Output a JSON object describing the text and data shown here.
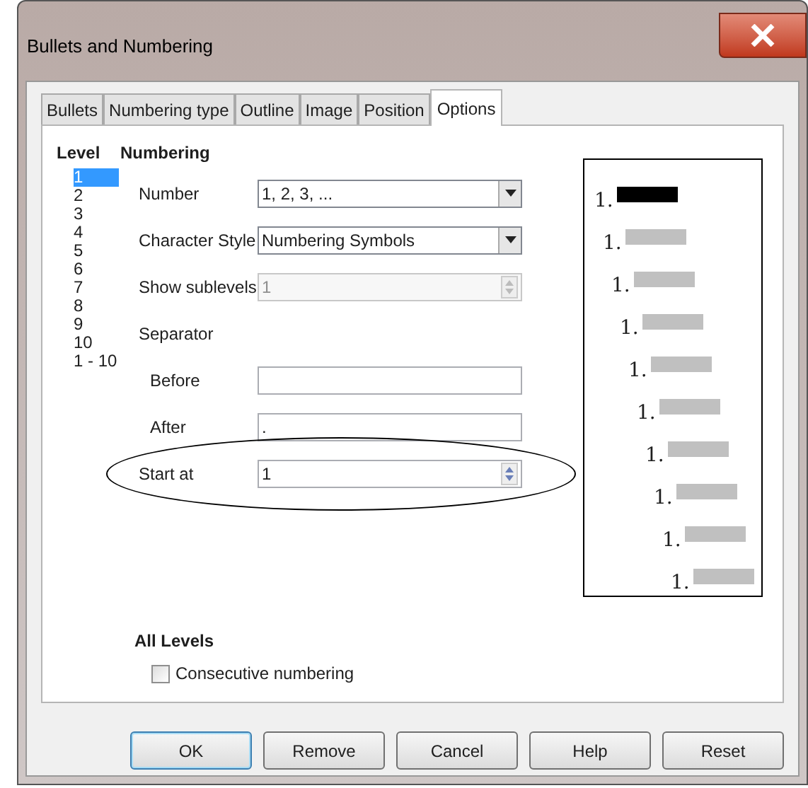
{
  "window": {
    "title": "Bullets and Numbering"
  },
  "tabs": [
    {
      "label": "Bullets",
      "selected": false
    },
    {
      "label": "Numbering type",
      "selected": false
    },
    {
      "label": "Outline",
      "selected": false
    },
    {
      "label": "Image",
      "selected": false
    },
    {
      "label": "Position",
      "selected": false
    },
    {
      "label": "Options",
      "selected": true
    }
  ],
  "level": {
    "heading": "Level",
    "items": [
      {
        "label": "1",
        "selected": true
      },
      {
        "label": "2",
        "selected": false
      },
      {
        "label": "3",
        "selected": false
      },
      {
        "label": "4",
        "selected": false
      },
      {
        "label": "5",
        "selected": false
      },
      {
        "label": "6",
        "selected": false
      },
      {
        "label": "7",
        "selected": false
      },
      {
        "label": "8",
        "selected": false
      },
      {
        "label": "9",
        "selected": false
      },
      {
        "label": "10",
        "selected": false
      },
      {
        "label": "1 - 10",
        "selected": false
      }
    ]
  },
  "numbering": {
    "heading": "Numbering",
    "rows": [
      {
        "kind": "dropdown",
        "label": "Number",
        "value": "1, 2, 3, ...",
        "disabled": false,
        "circled": false
      },
      {
        "kind": "dropdown",
        "label": "Character Style",
        "value": "Numbering Symbols",
        "disabled": false,
        "circled": false
      },
      {
        "kind": "spin",
        "label": "Show sublevels",
        "value": "1",
        "disabled": true,
        "circled": false
      },
      {
        "kind": "heading",
        "label": "Separator"
      },
      {
        "kind": "text",
        "label": "Before",
        "value": "",
        "indented": true
      },
      {
        "kind": "text",
        "label": "After",
        "value": ".",
        "indented": true
      },
      {
        "kind": "spin",
        "label": "Start at",
        "value": "1",
        "disabled": false,
        "circled": true
      }
    ]
  },
  "preview": {
    "lines": [
      {
        "number": "1.",
        "selected": true
      },
      {
        "number": "1.",
        "selected": false
      },
      {
        "number": "1.",
        "selected": false
      },
      {
        "number": "1.",
        "selected": false
      },
      {
        "number": "1.",
        "selected": false
      },
      {
        "number": "1.",
        "selected": false
      },
      {
        "number": "1.",
        "selected": false
      },
      {
        "number": "1.",
        "selected": false
      },
      {
        "number": "1.",
        "selected": false
      },
      {
        "number": "1.",
        "selected": false
      }
    ]
  },
  "all_levels": {
    "heading": "All Levels",
    "checkbox": {
      "label": "Consecutive numbering",
      "checked": false
    }
  },
  "buttons": [
    {
      "label": "OK",
      "default": true
    },
    {
      "label": "Remove",
      "default": false
    },
    {
      "label": "Cancel",
      "default": false
    },
    {
      "label": "Help",
      "default": false
    },
    {
      "label": "Reset",
      "default": false
    }
  ]
}
